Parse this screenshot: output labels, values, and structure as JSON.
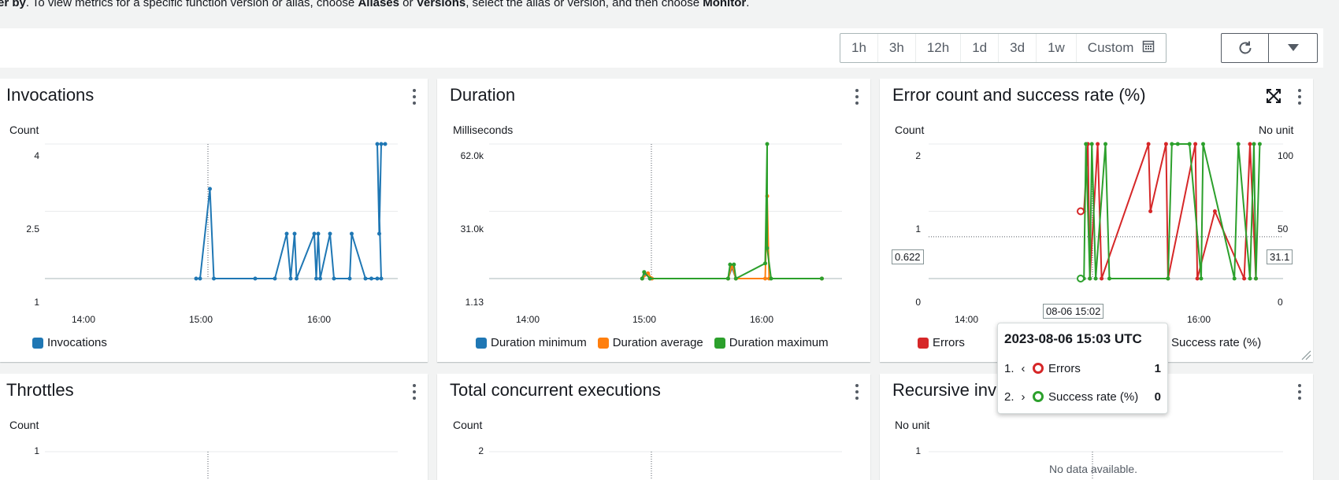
{
  "header": {
    "text_a": "ter by",
    "text_b": ". To view metrics for a specific function version or alias, choose ",
    "text_c": "Aliases",
    "text_d": " or ",
    "text_e": "Versions",
    "text_f": ", select the alias or version, and then choose ",
    "text_g": "Monitor",
    "text_h": "."
  },
  "toolbar": {
    "ranges": [
      "1h",
      "3h",
      "12h",
      "1d",
      "3d",
      "1w"
    ],
    "custom_label": "Custom",
    "icons": [
      "calendar-icon",
      "refresh-icon",
      "caret-down-icon"
    ]
  },
  "colors": {
    "blue": "#1f77b4",
    "orange": "#ff7f0e",
    "green": "#2ca02c",
    "red": "#d62728"
  },
  "widgets": {
    "invocations": {
      "title": "Invocations",
      "unit": "Count",
      "y_ticks": [
        "4",
        "2.5",
        "1"
      ],
      "x_ticks": [
        "14:00",
        "15:00",
        "16:00"
      ],
      "legend": [
        "Invocations"
      ]
    },
    "duration": {
      "title": "Duration",
      "unit": "Milliseconds",
      "y_ticks": [
        "62.0k",
        "31.0k",
        "1.13"
      ],
      "x_ticks": [
        "14:00",
        "15:00",
        "16:00"
      ],
      "legend": [
        "Duration minimum",
        "Duration average",
        "Duration maximum"
      ]
    },
    "errors": {
      "title": "Error count and success rate (%)",
      "unit_left": "Count",
      "unit_right": "No unit",
      "y_ticks_left": [
        "2",
        "1",
        "0"
      ],
      "y_ticks_right": [
        "100",
        "50",
        "0"
      ],
      "x_ticks": [
        "14:00",
        "16:00"
      ],
      "legend": [
        "Errors",
        "Success rate (%)"
      ],
      "cross_left": "0.622",
      "cross_right": "31.1",
      "cross_x": "08-06 15:02"
    },
    "throttles": {
      "title": "Throttles",
      "unit": "Count",
      "y_ticks": [
        "1"
      ]
    },
    "concurrent": {
      "title": "Total concurrent executions",
      "unit": "Count",
      "y_ticks": [
        "2"
      ]
    },
    "recursive": {
      "title": "Recursive inv",
      "unit": "No unit",
      "y_ticks": [
        "1"
      ],
      "no_data": "No data available."
    }
  },
  "tooltip": {
    "title": "2023-08-06 15:03 UTC",
    "rows": [
      {
        "index": "1.",
        "label": "Errors",
        "value": "1"
      },
      {
        "index": "2.",
        "label": "Success rate (%)",
        "value": "0"
      }
    ]
  },
  "chart_data": [
    {
      "type": "line",
      "title": "Invocations",
      "ylabel": "Count",
      "ylim": [
        1,
        4
      ],
      "x_ticks": [
        "14:00",
        "15:00",
        "16:00"
      ],
      "series": [
        {
          "name": "Invocations",
          "points": [
            [
              "15:00",
              1
            ],
            [
              "15:02",
              1
            ],
            [
              "15:07",
              3
            ],
            [
              "15:09",
              1
            ],
            [
              "15:30",
              1
            ],
            [
              "15:40",
              1
            ],
            [
              "15:46",
              2
            ],
            [
              "15:48",
              1
            ],
            [
              "15:50",
              2
            ],
            [
              "15:51",
              1
            ],
            [
              "16:00",
              2
            ],
            [
              "16:01",
              1
            ],
            [
              "16:02",
              2
            ],
            [
              "16:03",
              1
            ],
            [
              "16:08",
              2
            ],
            [
              "16:10",
              1
            ],
            [
              "16:18",
              1
            ],
            [
              "16:19",
              2
            ],
            [
              "16:26",
              1
            ],
            [
              "16:29",
              1
            ],
            [
              "16:32",
              1
            ],
            [
              "16:34",
              1
            ],
            [
              "16:32",
              4
            ],
            [
              "16:33",
              2
            ],
            [
              "16:34",
              4
            ],
            [
              "16:36",
              4
            ]
          ]
        }
      ]
    },
    {
      "type": "line",
      "title": "Duration",
      "ylabel": "Milliseconds",
      "ylim": [
        1.13,
        62000
      ],
      "x_ticks": [
        "14:00",
        "15:00",
        "16:00"
      ],
      "series": [
        {
          "name": "Duration minimum",
          "points": [
            [
              "15:01",
              1.13
            ],
            [
              "15:03",
              2000
            ],
            [
              "15:05",
              1.13
            ],
            [
              "15:45",
              1.13
            ],
            [
              "15:47",
              5000
            ],
            [
              "15:49",
              1.13
            ],
            [
              "16:33",
              1.13
            ]
          ]
        },
        {
          "name": "Duration average",
          "points": [
            [
              "15:01",
              1.13
            ],
            [
              "15:04",
              2400
            ],
            [
              "15:06",
              1.13
            ],
            [
              "15:45",
              1.13
            ],
            [
              "15:47",
              6000
            ],
            [
              "15:49",
              1.13
            ],
            [
              "16:04",
              1.13
            ],
            [
              "16:05",
              38000
            ],
            [
              "16:06",
              1.13
            ],
            [
              "16:33",
              1.13
            ]
          ]
        },
        {
          "name": "Duration maximum",
          "points": [
            [
              "15:01",
              1.13
            ],
            [
              "15:02",
              3000
            ],
            [
              "15:05",
              1.13
            ],
            [
              "15:45",
              1.13
            ],
            [
              "15:46",
              6500
            ],
            [
              "15:48",
              6500
            ],
            [
              "15:49",
              1.13
            ],
            [
              "16:04",
              7000
            ],
            [
              "16:05",
              62000
            ],
            [
              "16:05",
              14000
            ],
            [
              "16:07",
              1.13
            ],
            [
              "16:33",
              1.13
            ]
          ]
        }
      ]
    },
    {
      "type": "line",
      "title": "Error count and success rate (%)",
      "ylabel": "Count",
      "ylabel_right": "No unit",
      "ylim": [
        0,
        2
      ],
      "ylim_right": [
        0,
        100
      ],
      "x_ticks": [
        "14:00",
        "16:00"
      ],
      "series": [
        {
          "name": "Errors",
          "axis": "left",
          "points": [
            [
              "15:03",
              1
            ],
            [
              "15:05",
              2
            ],
            [
              "15:06",
              0
            ],
            [
              "15:10",
              2
            ],
            [
              "15:12",
              0
            ],
            [
              "15:36",
              2
            ],
            [
              "15:37",
              1
            ],
            [
              "15:45",
              2
            ],
            [
              "15:46",
              0
            ],
            [
              "16:00",
              2
            ],
            [
              "16:01",
              0
            ],
            [
              "16:10",
              1
            ],
            [
              "16:25",
              0
            ],
            [
              "16:28",
              2
            ],
            [
              "16:31",
              0
            ]
          ]
        },
        {
          "name": "Success rate (%)",
          "axis": "right",
          "points": [
            [
              "15:03",
              0
            ],
            [
              "15:04",
              100
            ],
            [
              "15:06",
              0
            ],
            [
              "15:07",
              100
            ],
            [
              "15:09",
              0
            ],
            [
              "15:14",
              100
            ],
            [
              "15:16",
              0
            ],
            [
              "15:46",
              0
            ],
            [
              "15:48",
              100
            ],
            [
              "15:51",
              100
            ],
            [
              "15:57",
              100
            ],
            [
              "16:03",
              0
            ],
            [
              "16:04",
              100
            ],
            [
              "16:20",
              0
            ],
            [
              "16:22",
              100
            ],
            [
              "16:28",
              0
            ],
            [
              "16:30",
              100
            ],
            [
              "16:31",
              0
            ],
            [
              "16:33",
              100
            ]
          ]
        }
      ]
    },
    {
      "type": "line",
      "title": "Throttles",
      "ylabel": "Count",
      "ylim": [
        0,
        1
      ],
      "series": []
    },
    {
      "type": "line",
      "title": "Total concurrent executions",
      "ylabel": "Count",
      "ylim": [
        0,
        2
      ],
      "series": []
    },
    {
      "type": "line",
      "title": "Recursive inv",
      "ylabel": "No unit",
      "ylim": [
        0,
        1
      ],
      "series": []
    }
  ]
}
